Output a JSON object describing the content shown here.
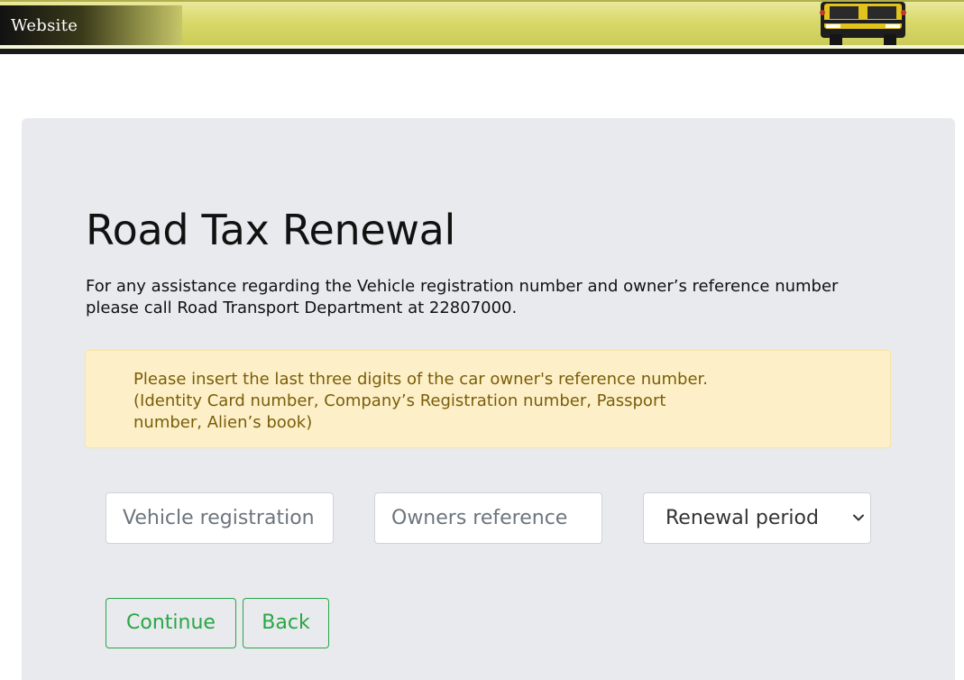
{
  "header": {
    "tab_label": "Website",
    "logo_icon": "school-bus-icon"
  },
  "main": {
    "title": "Road Tax Renewal",
    "assistance_text": "For any assistance regarding the Vehicle registration number and owner’s reference number please call Road Transport Department at 22807000.",
    "notice_text": "Please insert the last three digits of the car owner's reference number. (Identity Card number, Company’s Registration number, Passport number, Alien’s book)"
  },
  "form": {
    "vehicle_placeholder": "Vehicle registration number",
    "vehicle_value": "",
    "owner_placeholder": "Owners reference",
    "owner_value": "",
    "renewal_selected": "Renewal period",
    "renewal_icon": "chevron-down-icon"
  },
  "actions": {
    "continue_label": "Continue",
    "back_label": "Back"
  },
  "colors": {
    "banner": "#d8d86a",
    "panel": "#e8eaed",
    "notice_bg": "#fdf0c8",
    "notice_text": "#7a5d0a",
    "accent": "#28a745"
  }
}
